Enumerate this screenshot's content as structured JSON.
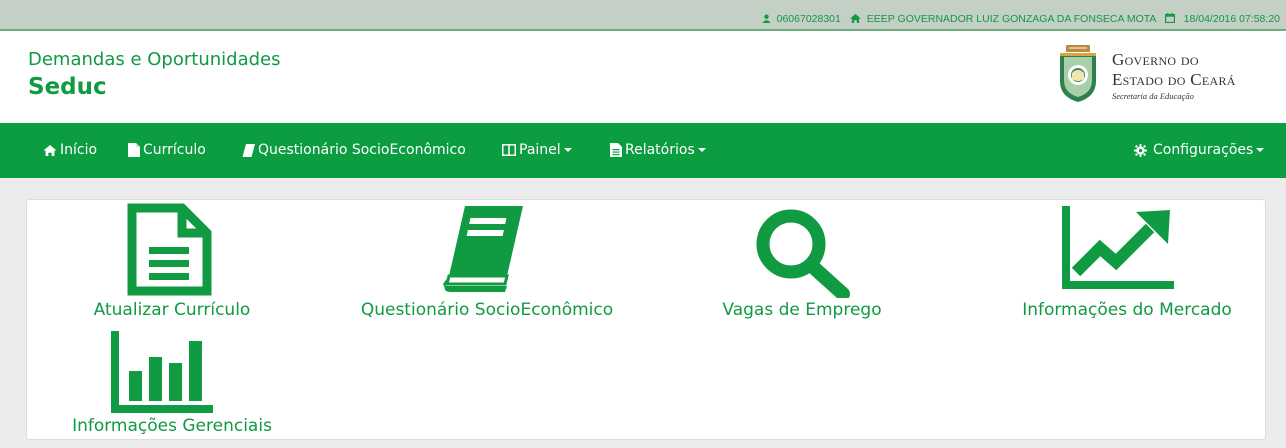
{
  "topbar": {
    "user_id": "06067028301",
    "school": "EEEP GOVERNADOR LUIZ GONZAGA DA FONSECA MOTA",
    "datetime": "18/04/2016 07:58:20"
  },
  "header": {
    "subtitle": "Demandas e Oportunidades",
    "title": "Seduc",
    "gov_line1": "Governo do",
    "gov_line2": "Estado do Ceará",
    "gov_line3": "Secretaria da Educação"
  },
  "nav": {
    "inicio": "Início",
    "curriculo": "Currículo",
    "questionario": "Questionário SocioEconômico",
    "painel": "Painel",
    "relatorios": "Relatórios",
    "configuracoes": "Configurações"
  },
  "tiles": {
    "atualizar": "Atualizar Currículo",
    "questionario": "Questionário SocioEconômico",
    "vagas": "Vagas de Emprego",
    "mercado": "Informações do Mercado",
    "gerenciais": "Informações Gerenciais"
  },
  "colors": {
    "brand_green": "#109a42",
    "navbar_green": "#0b9d3f",
    "topbar_bg": "#c4cfc6"
  }
}
